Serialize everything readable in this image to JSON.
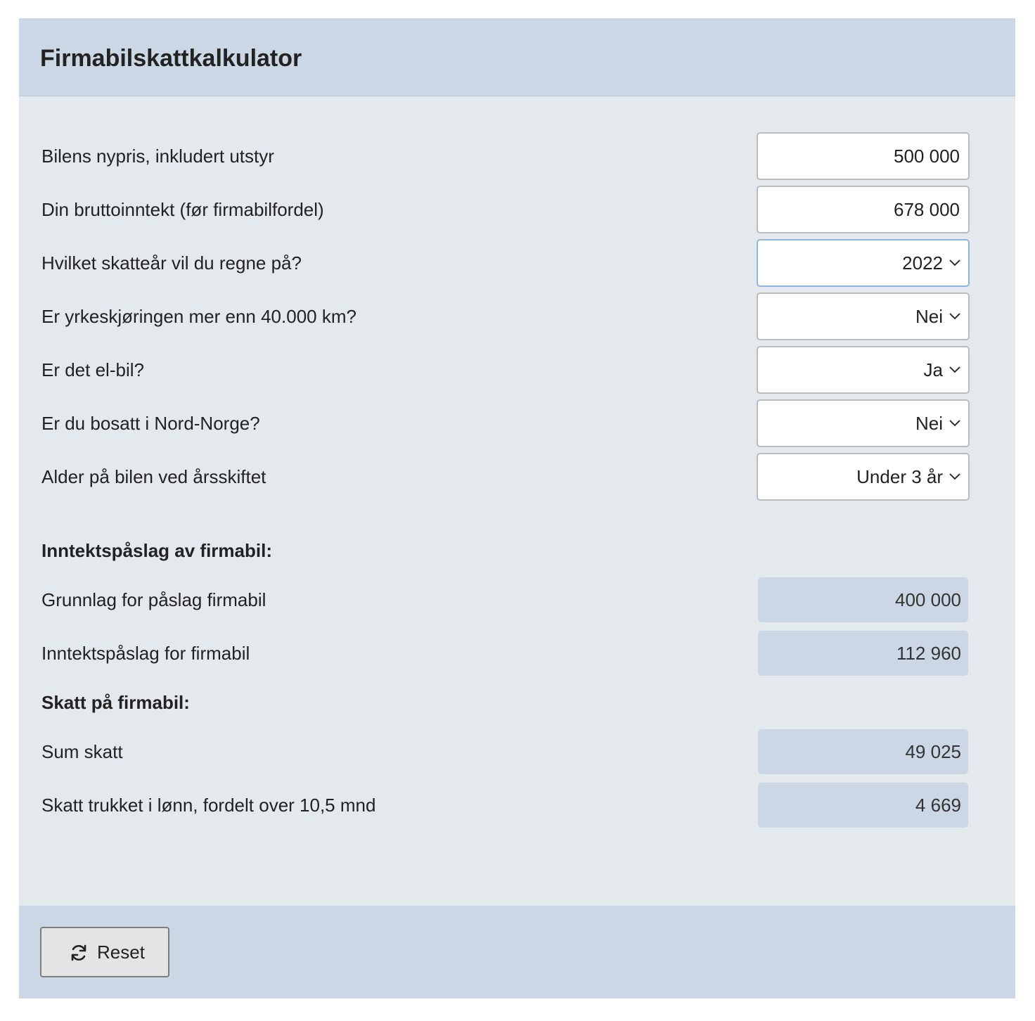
{
  "header": {
    "title": "Firmabilskattkalkulator"
  },
  "inputs": {
    "car_price": {
      "label": "Bilens nypris, inkludert utstyr",
      "value": "500 000"
    },
    "gross_income": {
      "label": "Din bruttoinntekt (før firmabilfordel)",
      "value": "678 000"
    },
    "tax_year": {
      "label": "Hvilket skatteår vil du regne på?",
      "selected": "2022"
    },
    "business_driving": {
      "label": "Er yrkeskjøringen mer enn 40.000 km?",
      "selected": "Nei"
    },
    "electric_car": {
      "label": "Er det el-bil?",
      "selected": "Ja"
    },
    "north_norway": {
      "label": "Er du bosatt i Nord-Norge?",
      "selected": "Nei"
    },
    "car_age": {
      "label": "Alder på bilen ved årsskiftet",
      "selected": "Under 3 år"
    }
  },
  "income_section": {
    "title": "Inntektspåslag av firmabil:",
    "basis": {
      "label": "Grunnlag for påslag firmabil",
      "value": "400 000"
    },
    "addition": {
      "label": "Inntektspåslag for firmabil",
      "value": "112 960"
    }
  },
  "tax_section": {
    "title": "Skatt på firmabil:",
    "total": {
      "label": "Sum skatt",
      "value": "49 025"
    },
    "monthly": {
      "label": "Skatt trukket i lønn, fordelt over 10,5 mnd",
      "value": "4 669"
    }
  },
  "footer": {
    "reset_label": "Reset",
    "reset_icon": "refresh-icon"
  }
}
